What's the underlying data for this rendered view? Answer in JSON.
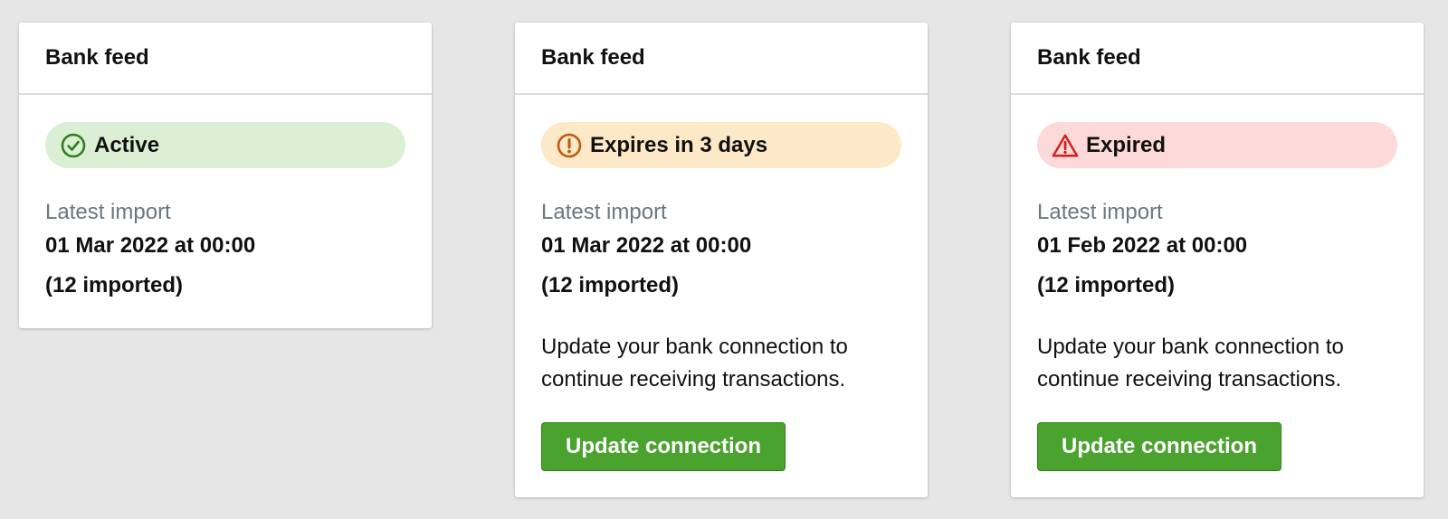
{
  "colors": {
    "page_background": "#e6e6e6",
    "active_bg": "#dbefd5",
    "active_icon": "#2f7d1d",
    "warning_bg": "#fde9c7",
    "warning_icon": "#c0580b",
    "error_bg": "#fdd9d9",
    "error_icon": "#d81b1b",
    "button_bg": "#4aa32e"
  },
  "cards": [
    {
      "title": "Bank feed",
      "status": {
        "label": "Active",
        "icon": "check-circle-icon",
        "tone": "success"
      },
      "latest_import_label": "Latest import",
      "latest_import_date": "01 Mar 2022 at 00:00",
      "imported_count": "(12 imported)"
    },
    {
      "title": "Bank feed",
      "status": {
        "label": "Expires in 3 days",
        "icon": "exclamation-circle-icon",
        "tone": "warning"
      },
      "latest_import_label": "Latest import",
      "latest_import_date": "01 Mar 2022 at 00:00",
      "imported_count": "(12 imported)",
      "message_line1": "Update your bank connection to",
      "message_line2": "continue receiving transactions.",
      "button_label": "Update connection"
    },
    {
      "title": "Bank feed",
      "status": {
        "label": "Expired",
        "icon": "warning-triangle-icon",
        "tone": "error"
      },
      "latest_import_label": "Latest import",
      "latest_import_date": "01 Feb 2022 at 00:00",
      "imported_count": "(12 imported)",
      "message_line1": "Update your bank connection to",
      "message_line2": "continue receiving transactions.",
      "button_label": "Update connection"
    }
  ]
}
